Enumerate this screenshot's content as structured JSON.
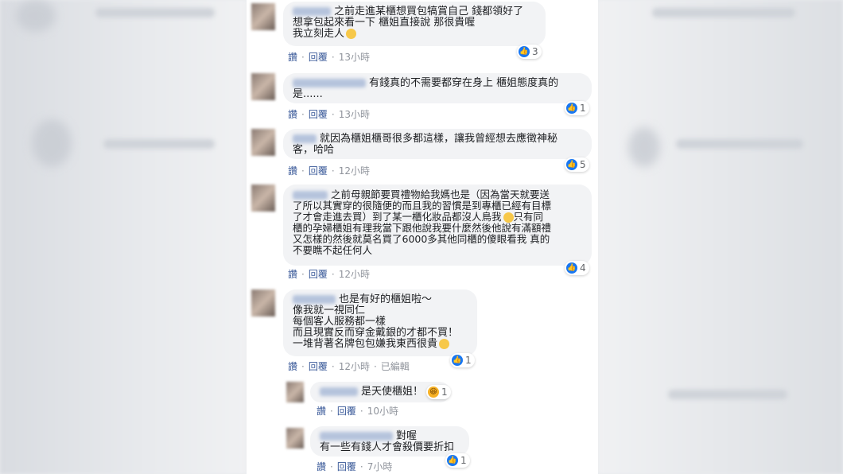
{
  "colors": {
    "link": "#385898",
    "like": "#1877f2",
    "bubble": "#f2f3f5"
  },
  "labels": {
    "like": "讚",
    "reply": "回覆",
    "edited": "已編輯"
  },
  "comments": [
    {
      "lines": [
        "之前走進某櫃想買包犒賞自己 錢都領好了",
        "想拿包起來看一下 櫃姐直接說 那很貴喔",
        "我立刻走人"
      ],
      "time": "13小時",
      "reactions": "3"
    },
    {
      "lines": [
        "有錢真的不需要都穿在身上 櫃姐態度真的",
        "是......"
      ],
      "time": "13小時",
      "reactions": "1"
    },
    {
      "lines": [
        "就因為櫃姐櫃哥很多都這樣，讓我曾經想去應徵神秘",
        "客，哈哈"
      ],
      "time": "12小時",
      "reactions": "5"
    },
    {
      "lines": [
        "之前母親節要買禮物給我媽也是（因為當天就要送",
        "了所以其實穿的很隨便的而且我的習慣是到專櫃已經有目標",
        "了才會走進去買）到了某一櫃化妝品都沒人鳥我",
        "只有同",
        "櫃的孕婦櫃姐有理我當下跟他說我要什麼然後他說有滿額禮",
        "又怎樣的然後就莫名買了6000多其他同櫃的傻眼看我 真的",
        "不要瞧不起任何人"
      ],
      "time": "12小時",
      "reactions": "4"
    },
    {
      "lines": [
        "也是有好的櫃姐啦～",
        "像我就一視同仁",
        "每個客人服務都一樣",
        "而且現實反而穿金戴銀的才都不買！",
        "一堆背著名牌包包嫌我東西很貴"
      ],
      "time": "12小時",
      "reactions": "1"
    }
  ],
  "replies": [
    {
      "text": "是天使櫃姐！",
      "time": "10小時",
      "reactions": "1"
    },
    {
      "lines": [
        "對喔",
        "有一些有錢人才會殺價要折扣"
      ],
      "time": "7小時",
      "reactions": "1"
    }
  ]
}
